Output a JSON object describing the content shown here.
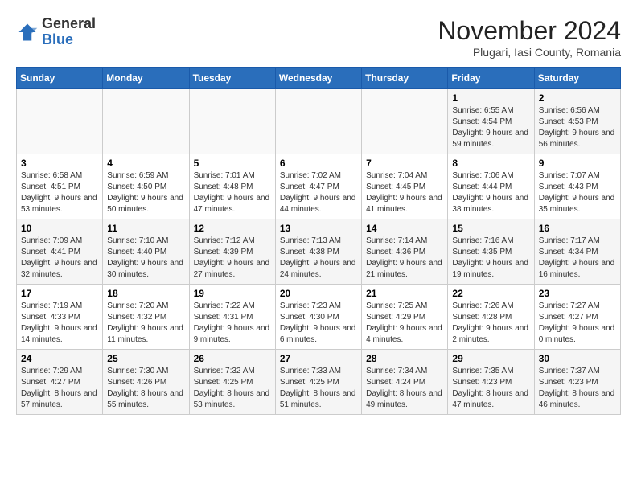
{
  "header": {
    "logo_general": "General",
    "logo_blue": "Blue",
    "month_title": "November 2024",
    "location": "Plugari, Iasi County, Romania"
  },
  "weekdays": [
    "Sunday",
    "Monday",
    "Tuesday",
    "Wednesday",
    "Thursday",
    "Friday",
    "Saturday"
  ],
  "weeks": [
    [
      {
        "day": "",
        "info": ""
      },
      {
        "day": "",
        "info": ""
      },
      {
        "day": "",
        "info": ""
      },
      {
        "day": "",
        "info": ""
      },
      {
        "day": "",
        "info": ""
      },
      {
        "day": "1",
        "info": "Sunrise: 6:55 AM\nSunset: 4:54 PM\nDaylight: 9 hours and 59 minutes."
      },
      {
        "day": "2",
        "info": "Sunrise: 6:56 AM\nSunset: 4:53 PM\nDaylight: 9 hours and 56 minutes."
      }
    ],
    [
      {
        "day": "3",
        "info": "Sunrise: 6:58 AM\nSunset: 4:51 PM\nDaylight: 9 hours and 53 minutes."
      },
      {
        "day": "4",
        "info": "Sunrise: 6:59 AM\nSunset: 4:50 PM\nDaylight: 9 hours and 50 minutes."
      },
      {
        "day": "5",
        "info": "Sunrise: 7:01 AM\nSunset: 4:48 PM\nDaylight: 9 hours and 47 minutes."
      },
      {
        "day": "6",
        "info": "Sunrise: 7:02 AM\nSunset: 4:47 PM\nDaylight: 9 hours and 44 minutes."
      },
      {
        "day": "7",
        "info": "Sunrise: 7:04 AM\nSunset: 4:45 PM\nDaylight: 9 hours and 41 minutes."
      },
      {
        "day": "8",
        "info": "Sunrise: 7:06 AM\nSunset: 4:44 PM\nDaylight: 9 hours and 38 minutes."
      },
      {
        "day": "9",
        "info": "Sunrise: 7:07 AM\nSunset: 4:43 PM\nDaylight: 9 hours and 35 minutes."
      }
    ],
    [
      {
        "day": "10",
        "info": "Sunrise: 7:09 AM\nSunset: 4:41 PM\nDaylight: 9 hours and 32 minutes."
      },
      {
        "day": "11",
        "info": "Sunrise: 7:10 AM\nSunset: 4:40 PM\nDaylight: 9 hours and 30 minutes."
      },
      {
        "day": "12",
        "info": "Sunrise: 7:12 AM\nSunset: 4:39 PM\nDaylight: 9 hours and 27 minutes."
      },
      {
        "day": "13",
        "info": "Sunrise: 7:13 AM\nSunset: 4:38 PM\nDaylight: 9 hours and 24 minutes."
      },
      {
        "day": "14",
        "info": "Sunrise: 7:14 AM\nSunset: 4:36 PM\nDaylight: 9 hours and 21 minutes."
      },
      {
        "day": "15",
        "info": "Sunrise: 7:16 AM\nSunset: 4:35 PM\nDaylight: 9 hours and 19 minutes."
      },
      {
        "day": "16",
        "info": "Sunrise: 7:17 AM\nSunset: 4:34 PM\nDaylight: 9 hours and 16 minutes."
      }
    ],
    [
      {
        "day": "17",
        "info": "Sunrise: 7:19 AM\nSunset: 4:33 PM\nDaylight: 9 hours and 14 minutes."
      },
      {
        "day": "18",
        "info": "Sunrise: 7:20 AM\nSunset: 4:32 PM\nDaylight: 9 hours and 11 minutes."
      },
      {
        "day": "19",
        "info": "Sunrise: 7:22 AM\nSunset: 4:31 PM\nDaylight: 9 hours and 9 minutes."
      },
      {
        "day": "20",
        "info": "Sunrise: 7:23 AM\nSunset: 4:30 PM\nDaylight: 9 hours and 6 minutes."
      },
      {
        "day": "21",
        "info": "Sunrise: 7:25 AM\nSunset: 4:29 PM\nDaylight: 9 hours and 4 minutes."
      },
      {
        "day": "22",
        "info": "Sunrise: 7:26 AM\nSunset: 4:28 PM\nDaylight: 9 hours and 2 minutes."
      },
      {
        "day": "23",
        "info": "Sunrise: 7:27 AM\nSunset: 4:27 PM\nDaylight: 9 hours and 0 minutes."
      }
    ],
    [
      {
        "day": "24",
        "info": "Sunrise: 7:29 AM\nSunset: 4:27 PM\nDaylight: 8 hours and 57 minutes."
      },
      {
        "day": "25",
        "info": "Sunrise: 7:30 AM\nSunset: 4:26 PM\nDaylight: 8 hours and 55 minutes."
      },
      {
        "day": "26",
        "info": "Sunrise: 7:32 AM\nSunset: 4:25 PM\nDaylight: 8 hours and 53 minutes."
      },
      {
        "day": "27",
        "info": "Sunrise: 7:33 AM\nSunset: 4:25 PM\nDaylight: 8 hours and 51 minutes."
      },
      {
        "day": "28",
        "info": "Sunrise: 7:34 AM\nSunset: 4:24 PM\nDaylight: 8 hours and 49 minutes."
      },
      {
        "day": "29",
        "info": "Sunrise: 7:35 AM\nSunset: 4:23 PM\nDaylight: 8 hours and 47 minutes."
      },
      {
        "day": "30",
        "info": "Sunrise: 7:37 AM\nSunset: 4:23 PM\nDaylight: 8 hours and 46 minutes."
      }
    ]
  ]
}
